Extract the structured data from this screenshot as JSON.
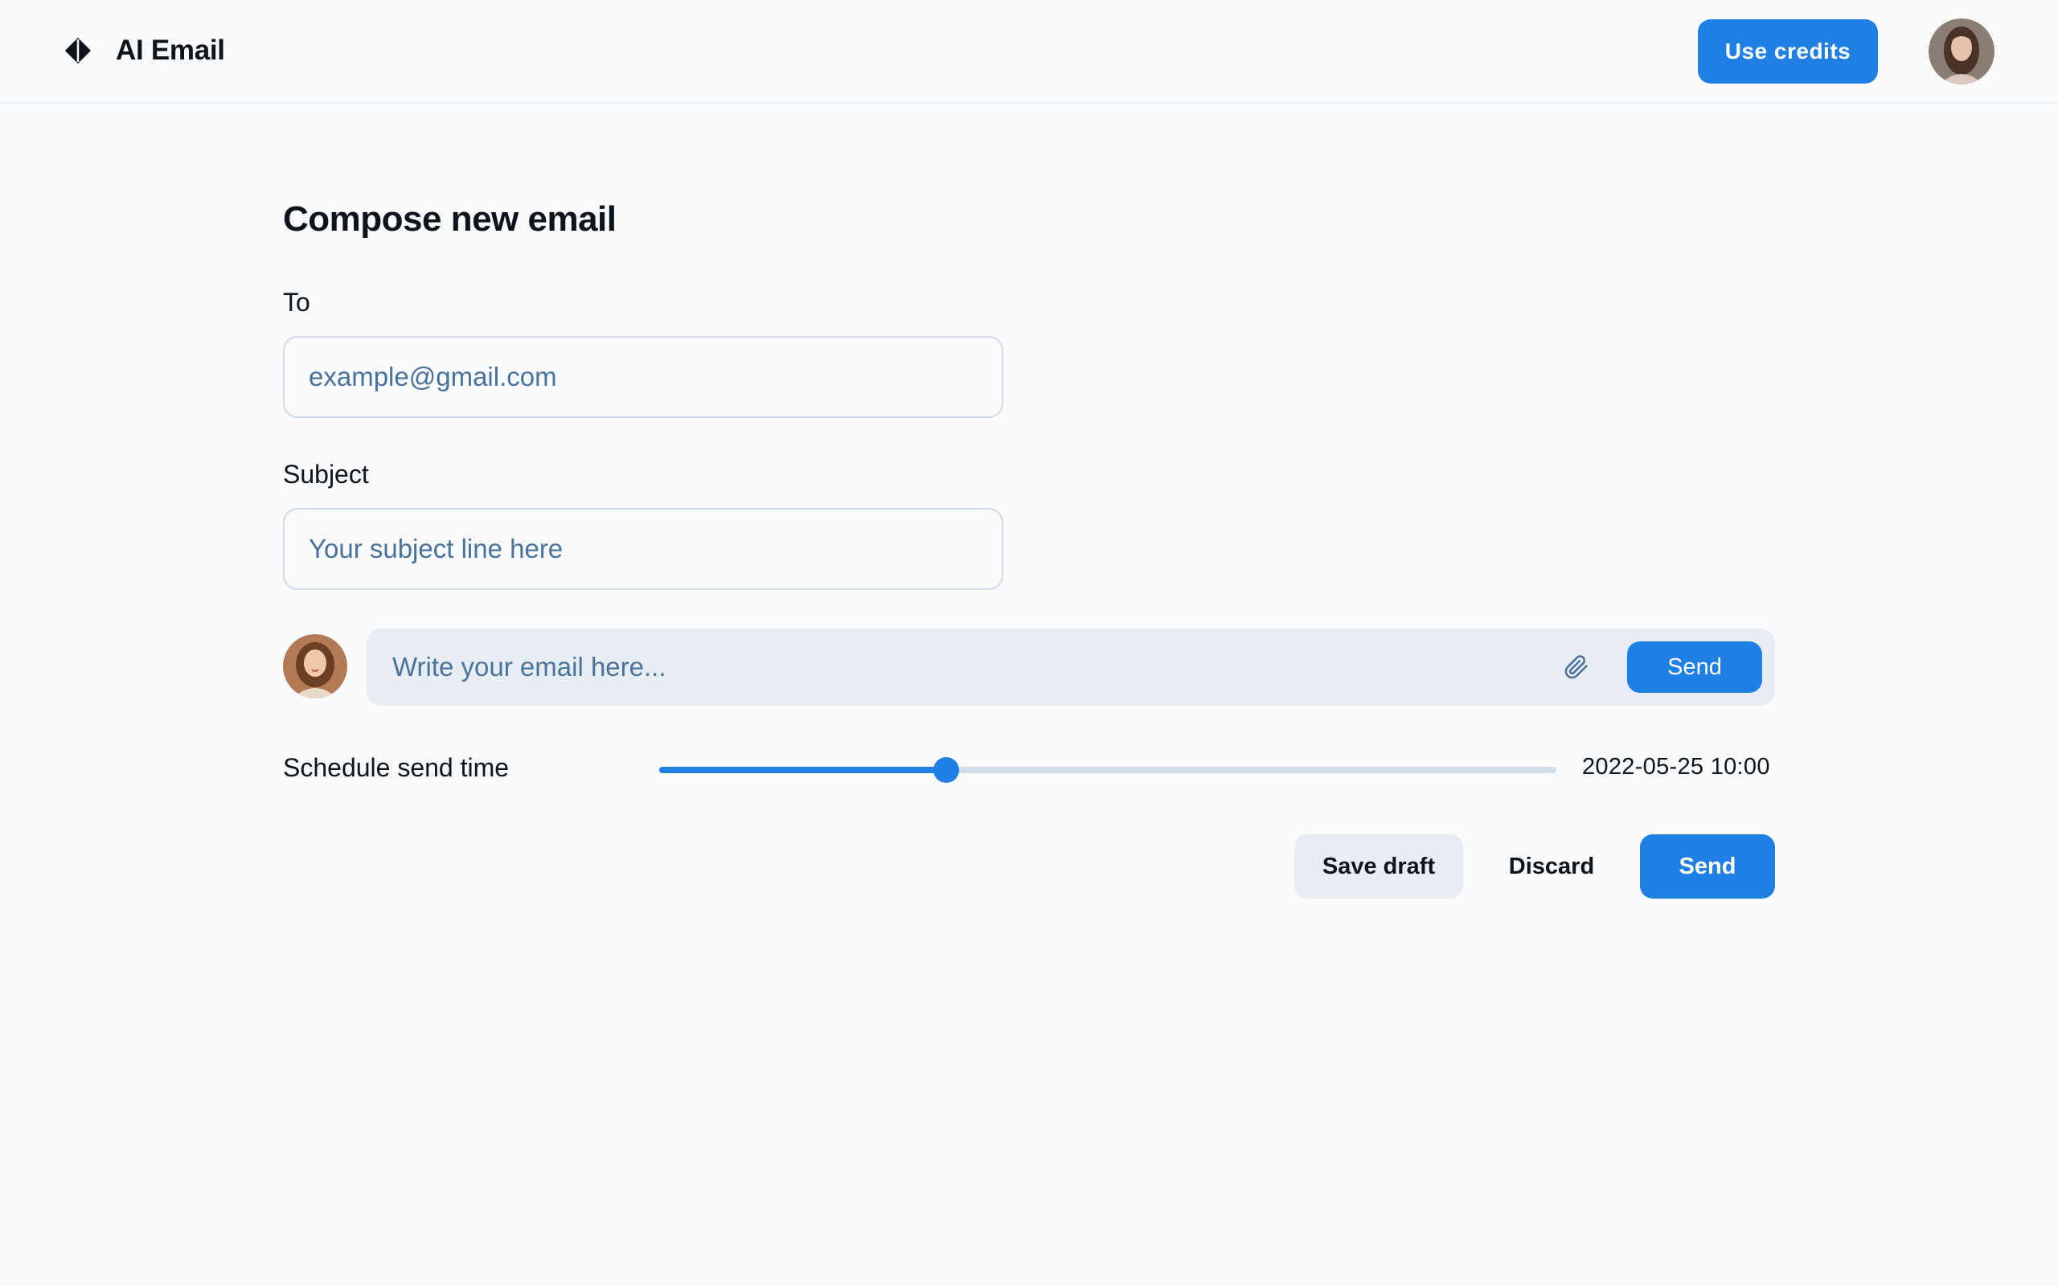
{
  "app": {
    "title": "AI Email",
    "logo_icon": "diamond-icon"
  },
  "header": {
    "credits_label": "Use credits",
    "avatar_icon": "user-avatar"
  },
  "compose": {
    "title": "Compose new email",
    "to": {
      "label": "To",
      "value": "",
      "placeholder": "example@gmail.com"
    },
    "subject": {
      "label": "Subject",
      "value": "",
      "placeholder": "Your subject line here"
    },
    "body": {
      "value": "",
      "placeholder": "Write your email here...",
      "attach_icon": "paperclip-icon",
      "send_label": "Send"
    },
    "schedule": {
      "label": "Schedule send time",
      "value": "2022-05-25 10:00",
      "slider_fraction": 0.32
    },
    "actions": {
      "save_draft": "Save draft",
      "discard": "Discard",
      "send": "Send"
    }
  },
  "colors": {
    "accent": "#1f7fe3",
    "background": "#f8fafc",
    "muted_text": "#49739c",
    "field_fill": "#e7edf2"
  }
}
